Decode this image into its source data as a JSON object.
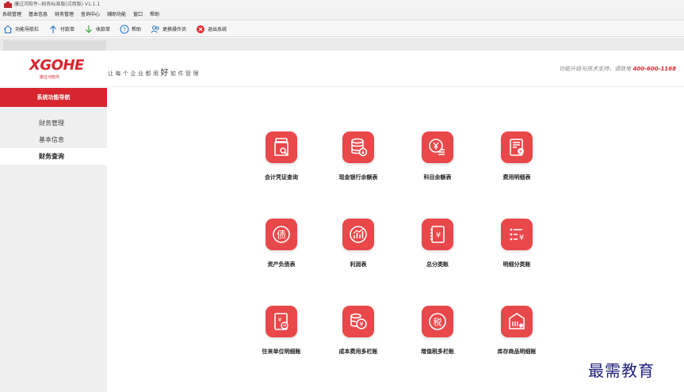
{
  "window": {
    "title": "康过河软件--财务标准版(试用版) V1.1.1"
  },
  "menu": {
    "items": [
      "系统管理",
      "基本信息",
      "财务管理",
      "查询中心",
      "辅助功能",
      "窗口",
      "帮助"
    ]
  },
  "toolbar": {
    "buttons": [
      {
        "label": "功能导航栏",
        "icon": "home-icon"
      },
      {
        "label": "付款单",
        "icon": "arrow-up-icon"
      },
      {
        "label": "收款单",
        "icon": "arrow-down-icon"
      },
      {
        "label": "帮助",
        "icon": "help-icon"
      },
      {
        "label": "更换操作员",
        "icon": "users-icon"
      },
      {
        "label": "退出系统",
        "icon": "exit-icon"
      }
    ]
  },
  "header": {
    "brand": "XGOHE",
    "brand_sub": "康过河软件",
    "slogan_before": "让每个企业都用",
    "slogan_emph": "好",
    "slogan_after": "软件管理",
    "support_text": "功能升级与技术支持，请致电 ",
    "support_phone": "400-600-1168"
  },
  "sidebar": {
    "title": "系统功能导航",
    "items": [
      {
        "label": "财务管理",
        "active": false
      },
      {
        "label": "基本信息",
        "active": false
      },
      {
        "label": "财务查询",
        "active": true
      }
    ]
  },
  "tiles": [
    {
      "label": "会计凭证查询",
      "icon": "voucher-search-icon"
    },
    {
      "label": "现金银行余额表",
      "icon": "coin-database-icon"
    },
    {
      "label": "科目余额表",
      "icon": "yen-balance-icon"
    },
    {
      "label": "费用明细表",
      "icon": "expense-detail-icon"
    },
    {
      "label": "资产负债表",
      "icon": "debt-icon"
    },
    {
      "label": "利润表",
      "icon": "profit-chart-icon"
    },
    {
      "label": "总分类账",
      "icon": "ledger-yen-icon"
    },
    {
      "label": "明细分类账",
      "icon": "detail-list-icon"
    },
    {
      "label": "往来单位明细账",
      "icon": "contact-ledger-icon"
    },
    {
      "label": "成本费用多栏账",
      "icon": "cost-coins-icon"
    },
    {
      "label": "增值税多栏账",
      "icon": "tax-icon"
    },
    {
      "label": "库存商品明细账",
      "icon": "warehouse-icon"
    }
  ],
  "watermark": "最需教育",
  "colors": {
    "accent": "#d7262f",
    "tile": "#e9484a"
  }
}
